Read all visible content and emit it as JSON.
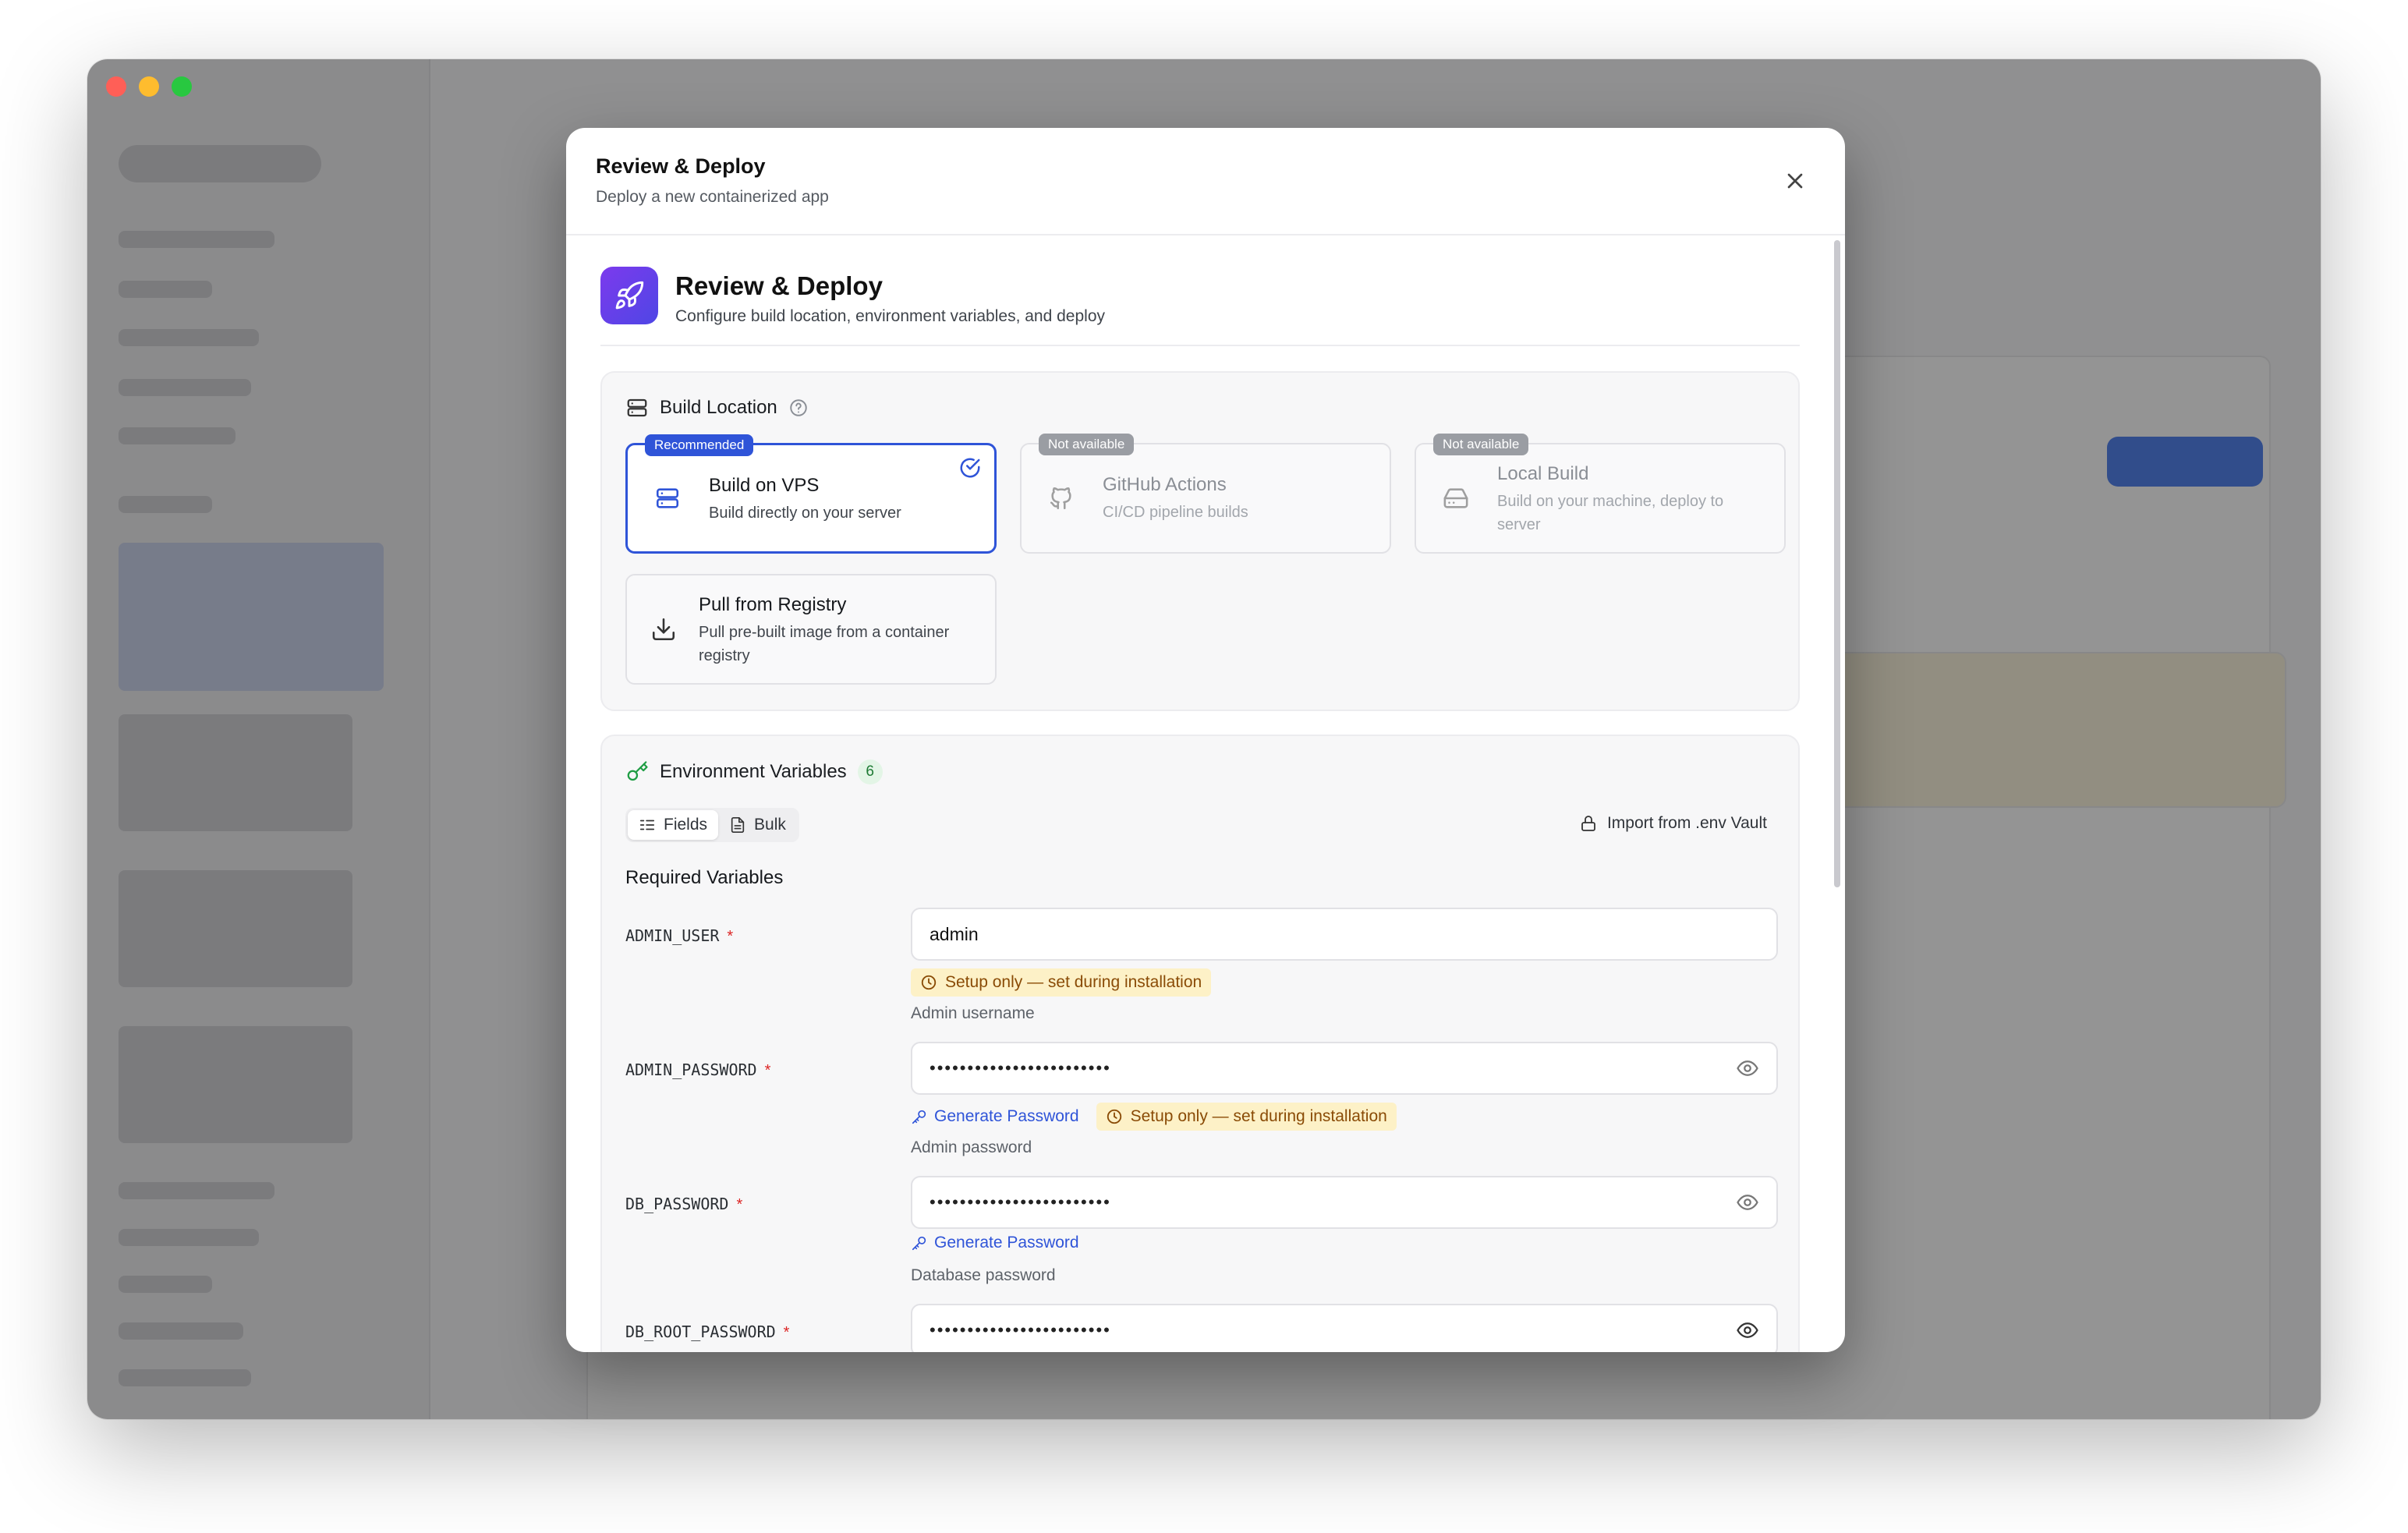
{
  "modal": {
    "title": "Review & Deploy",
    "subtitle": "Deploy a new containerized app"
  },
  "hero": {
    "title": "Review & Deploy",
    "subtitle": "Configure build location, environment variables, and deploy"
  },
  "build_location": {
    "heading": "Build Location",
    "options": [
      {
        "badge": "Recommended",
        "title": "Build on VPS",
        "description": "Build directly on your server",
        "icon": "server-icon",
        "selected": true,
        "available": true
      },
      {
        "badge": "Not available",
        "title": "GitHub Actions",
        "description": "CI/CD pipeline builds",
        "icon": "github-icon",
        "selected": false,
        "available": false
      },
      {
        "badge": "Not available",
        "title": "Local Build",
        "description": "Build on your machine, deploy to server",
        "icon": "hard-drive-icon",
        "selected": false,
        "available": false
      },
      {
        "badge": "",
        "title": "Pull from Registry",
        "description": "Pull pre-built image from a container registry",
        "icon": "download-icon",
        "selected": false,
        "available": true
      }
    ]
  },
  "env": {
    "heading": "Environment Variables",
    "count": "6",
    "tabs": [
      {
        "label": "Fields",
        "active": true
      },
      {
        "label": "Bulk",
        "active": false
      }
    ],
    "import_label": "Import from .env Vault",
    "required_heading": "Required Variables",
    "required_marker": "*",
    "generate_label": "Generate Password",
    "setup_only_label": "Setup only — set during installation",
    "variables": [
      {
        "name": "ADMIN_USER",
        "value": "admin",
        "type": "text",
        "setup_only": true,
        "generate": false,
        "help": "Admin username"
      },
      {
        "name": "ADMIN_PASSWORD",
        "value": "••••••••••••••••••••••••",
        "type": "password",
        "setup_only": true,
        "generate": true,
        "help": "Admin password"
      },
      {
        "name": "DB_PASSWORD",
        "value": "••••••••••••••••••••••••",
        "type": "password",
        "setup_only": false,
        "generate": true,
        "help": "Database password"
      },
      {
        "name": "DB_ROOT_PASSWORD",
        "value": "••••••••••••••••••••••••",
        "type": "password",
        "setup_only": false,
        "generate": true,
        "help": ""
      }
    ]
  },
  "colors": {
    "accent": "#2f54d8",
    "warning_bg": "#fdf1c7",
    "warning_text": "#8a4b06",
    "required": "#dc2626",
    "success": "#1e7a34"
  }
}
